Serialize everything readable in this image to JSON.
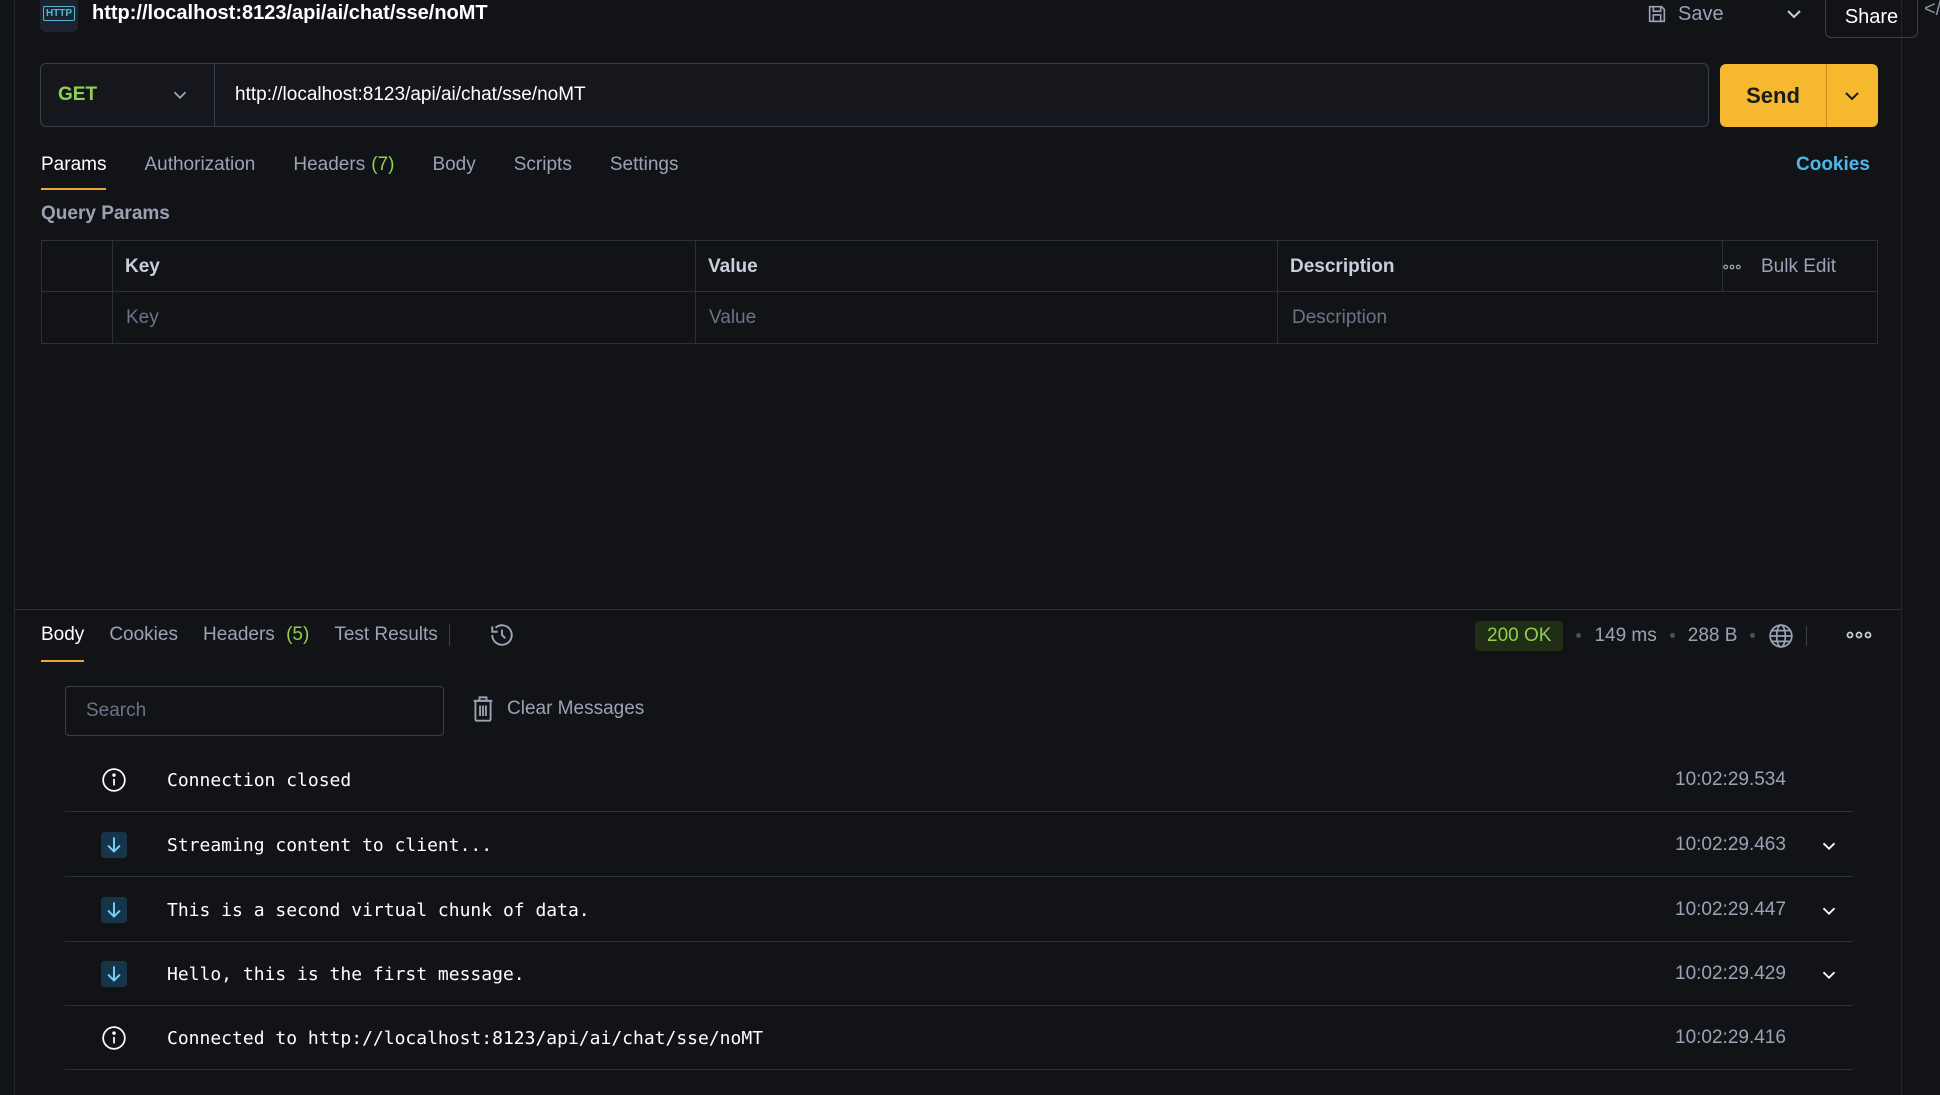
{
  "request": {
    "title": "http://localhost:8123/api/ai/chat/sse/noMT",
    "save_label": "Save",
    "share_label": "Share",
    "method": "GET",
    "url": "http://localhost:8123/api/ai/chat/sse/noMT",
    "send_label": "Send",
    "http_icon_label": "HTTP"
  },
  "request_tabs": {
    "params": "Params",
    "authorization": "Authorization",
    "headers": "Headers",
    "headers_count": "(7)",
    "body": "Body",
    "scripts": "Scripts",
    "settings": "Settings",
    "cookies": "Cookies"
  },
  "query_params": {
    "title": "Query Params",
    "columns": {
      "key": "Key",
      "value": "Value",
      "description": "Description"
    },
    "bulk_edit": "Bulk Edit",
    "placeholders": {
      "key": "Key",
      "value": "Value",
      "description": "Description"
    }
  },
  "response_tabs": {
    "body": "Body",
    "cookies": "Cookies",
    "headers": "Headers",
    "headers_count": "(5)",
    "test_results": "Test Results"
  },
  "response_status": {
    "status": "200 OK",
    "time": "149 ms",
    "size": "288 B"
  },
  "messages_panel": {
    "search_placeholder": "Search",
    "clear_label": "Clear Messages",
    "messages": [
      {
        "type": "info",
        "text": "Connection closed",
        "time": "10:02:29.534",
        "expandable": false
      },
      {
        "type": "incoming",
        "text": "Streaming content to client...",
        "time": "10:02:29.463",
        "expandable": true
      },
      {
        "type": "incoming",
        "text": "This is a second virtual chunk of data.",
        "time": "10:02:29.447",
        "expandable": true
      },
      {
        "type": "incoming",
        "text": "Hello, this is the first message.",
        "time": "10:02:29.429",
        "expandable": true
      },
      {
        "type": "info",
        "text": "Connected to http://localhost:8123/api/ai/chat/sse/noMT",
        "time": "10:02:29.416",
        "expandable": false
      }
    ]
  },
  "colors": {
    "background": "#111317",
    "accent_orange": "#f5b82e",
    "method_green": "#8fd14f",
    "link_blue": "#4fb6ec",
    "download_icon_bg": "#16354a"
  }
}
